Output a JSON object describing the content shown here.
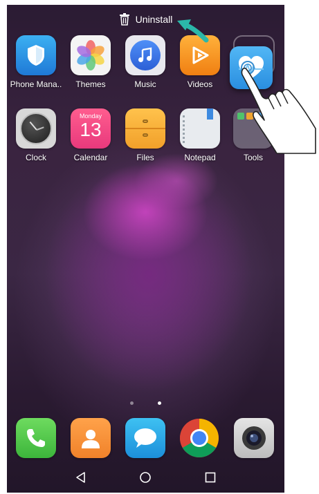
{
  "uninstall": {
    "label": "Uninstall"
  },
  "apps_row1": [
    {
      "label": "Phone Mana.."
    },
    {
      "label": "Themes"
    },
    {
      "label": "Music"
    },
    {
      "label": "Videos"
    }
  ],
  "apps_row2": [
    {
      "label": "Clock"
    },
    {
      "label": "Calendar",
      "day_name": "Monday",
      "day_number": "13"
    },
    {
      "label": "Files"
    },
    {
      "label": "Notepad"
    },
    {
      "label": "Tools"
    }
  ],
  "dock": [
    "phone-icon",
    "contacts-icon",
    "messaging-icon",
    "browser-icon",
    "camera-icon"
  ],
  "page_indicator": {
    "pages": 2,
    "current": 2
  },
  "colors": {
    "accent_arrow": "#2bb7a9"
  }
}
